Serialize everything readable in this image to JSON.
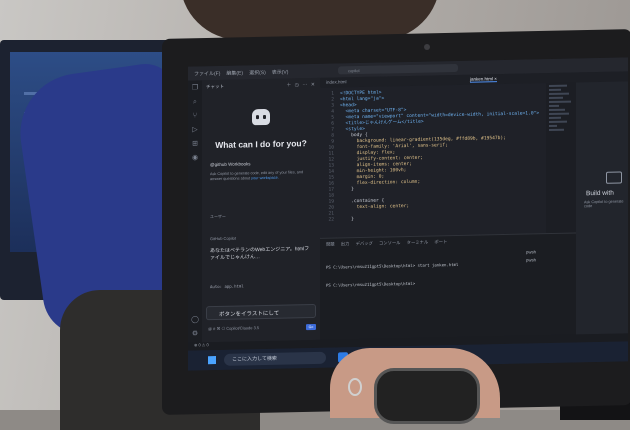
{
  "titlebar": {
    "menu": [
      "ファイル(F)",
      "編集(E)",
      "選択(S)",
      "表示(V)"
    ],
    "search": "copilot"
  },
  "chat": {
    "header": "チャット",
    "title": "What can I do for you?",
    "agent_name": "@github Workbooks",
    "agent_desc_1": "Ask Copilot to generate code, edit any of",
    "agent_desc_2": "your files, and answer questions about",
    "agent_desc_link": "your workspace.",
    "section_1": "ユーザー",
    "section_2": "GitHub Copilot",
    "msg_1": "あなたはベテランのWebエンジニア。htmlファイルでじゃんけん…",
    "code_ref": "Auto: app.html",
    "input_text": "ボタンをイラストにして",
    "footer": "@ # ⌘ ⎔ Copilot/Claude 3.5",
    "send": "Go"
  },
  "editor": {
    "tabs": [
      "index.html",
      "janken.html ×"
    ],
    "active_tab_index": 1,
    "line_numbers": [
      "1",
      "2",
      "3",
      "4",
      "5",
      "6",
      "7",
      "8",
      "9",
      "10",
      "11",
      "12",
      "13",
      "14",
      "15",
      "16",
      "17",
      "18",
      "19",
      "20",
      "21",
      "22"
    ],
    "code_lines": [
      "<!DOCTYPE html>",
      "<html lang=\"ja\">",
      "<head>",
      "  <meta charset=\"UTF-8\">",
      "  <meta name=\"viewport\" content=\"width=device-width, initial-scale=1.0\">",
      "  <title>じゃんけんゲーム</title>",
      "  <style>",
      "    body {",
      "      background: linear-gradient(135deg, #ffd89b, #19547b);",
      "      font-family: 'Arial', sans-serif;",
      "      display: flex;",
      "      justify-content: center;",
      "      align-items: center;",
      "      min-height: 100vh;",
      "      margin: 0;",
      "      flex-direction: column;",
      "    }",
      "",
      "    .container {",
      "      text-align: center;",
      "",
      "    }"
    ]
  },
  "right_panel": {
    "title": "Build with",
    "subtitle": "Ask Copilot to generate code"
  },
  "terminal": {
    "tabs": [
      "問題",
      "出力",
      "デバッグ コンソール",
      "ターミナル",
      "ポート"
    ],
    "lines": [
      "PS C:\\Users\\rmsu211gpt5\\Desktop\\html> start janken.html",
      "PS C:\\Users\\rmsu211gpt5\\Desktop\\html>"
    ],
    "sessions": [
      "pwsh",
      "pwsh"
    ]
  },
  "statusbar": {
    "text": "⊗ 0 ⚠ 0"
  },
  "taskbar": {
    "search_placeholder": "ここに入力して検索"
  }
}
